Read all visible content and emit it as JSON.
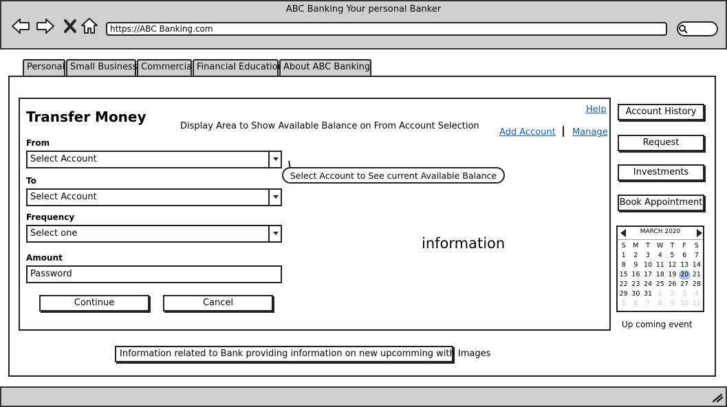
{
  "window": {
    "title": "ABC Banking Your personal Banker",
    "url": "https://ABC Banking.com"
  },
  "tabs": [
    {
      "label": "Personal"
    },
    {
      "label": "Small Business"
    },
    {
      "label": "Commercial"
    },
    {
      "label": "Financial Education"
    },
    {
      "label": "About ABC Banking"
    }
  ],
  "transfer": {
    "title": "Transfer Money",
    "display_note": "Display Area to Show Available Balance on From Account Selection",
    "help_link": "Help",
    "add_account_link": "Add Account",
    "manage_link": "Manage",
    "from_label": "From",
    "from_value": "Select Account",
    "to_label": "To",
    "to_value": "Select Account",
    "frequency_label": "Frequency",
    "frequency_value": "Select one",
    "amount_label": "Amount",
    "amount_value": "Password",
    "callout": "Select Account to See current Available Balance",
    "info_text": "information",
    "continue_label": "Continue",
    "cancel_label": "Cancel"
  },
  "sidebar": {
    "buttons": [
      {
        "label": "Account History"
      },
      {
        "label": "Request"
      },
      {
        "label": "Investments"
      },
      {
        "label": "Book Appointment"
      }
    ]
  },
  "calendar": {
    "month_label": "MARCH 2020",
    "weekdays": [
      "S",
      "M",
      "T",
      "W",
      "T",
      "F",
      "S"
    ],
    "days": [
      "1",
      "2",
      "3",
      "4",
      "5",
      "6",
      "7",
      "8",
      "9",
      "10",
      "11",
      "12",
      "13",
      "14",
      "15",
      "16",
      "17",
      "18",
      "19",
      "20",
      "21",
      "22",
      "23",
      "24",
      "25",
      "26",
      "27",
      "28",
      "29",
      "30",
      "31",
      "1",
      "2",
      "3",
      "4",
      "5",
      "6",
      "7",
      "8",
      "9",
      "10",
      "11"
    ],
    "selected_day": "20"
  },
  "upcoming_event": "Up coming event",
  "bank_info": "Information related to Bank providing information on new upcomming with Images",
  "colors": {
    "chrome": "#d0d0d0",
    "link": "#1a5ea8",
    "calendar_selected": "#a9c1e8"
  }
}
